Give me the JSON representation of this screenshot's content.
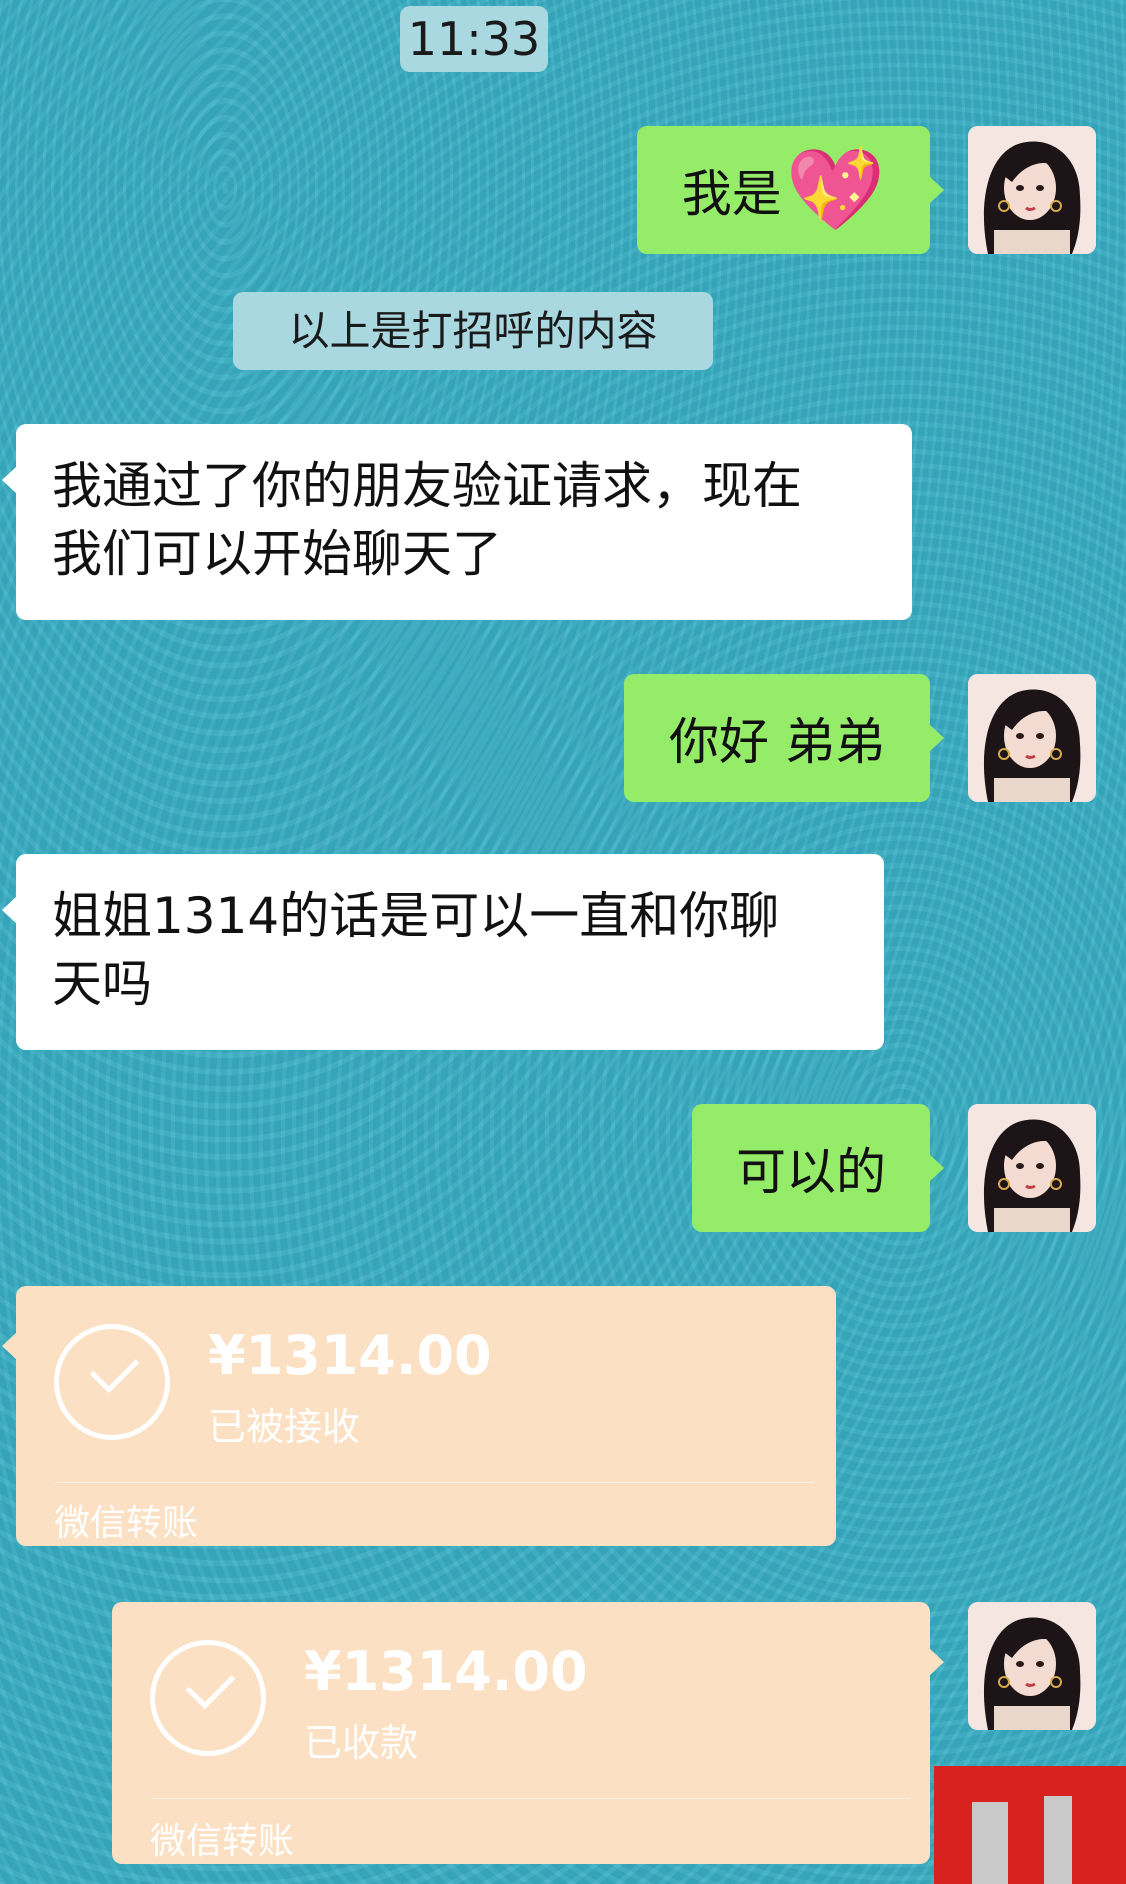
{
  "time": "11:33",
  "system_note": "以上是打招呼的内容",
  "messages": {
    "m1": {
      "text": "我是",
      "emoji": "💖"
    },
    "m2": {
      "line1": "我通过了你的朋友验证请求，现在",
      "line2": "我们可以开始聊天了"
    },
    "m3": {
      "text": "你好 弟弟"
    },
    "m4": {
      "line1": "姐姐1314的话是可以一直和你聊",
      "line2": "天吗"
    },
    "m5": {
      "text": "可以的"
    }
  },
  "transfer_received": {
    "amount": "¥1314.00",
    "status": "已被接收",
    "label": "微信转账"
  },
  "transfer_sent": {
    "amount": "¥1314.00",
    "status": "已收款",
    "label": "微信转账"
  },
  "colors": {
    "background": "#3aaec4",
    "bubble_sent": "#95ec69",
    "bubble_received": "#ffffff",
    "transfer_card": "#fce0c3"
  }
}
